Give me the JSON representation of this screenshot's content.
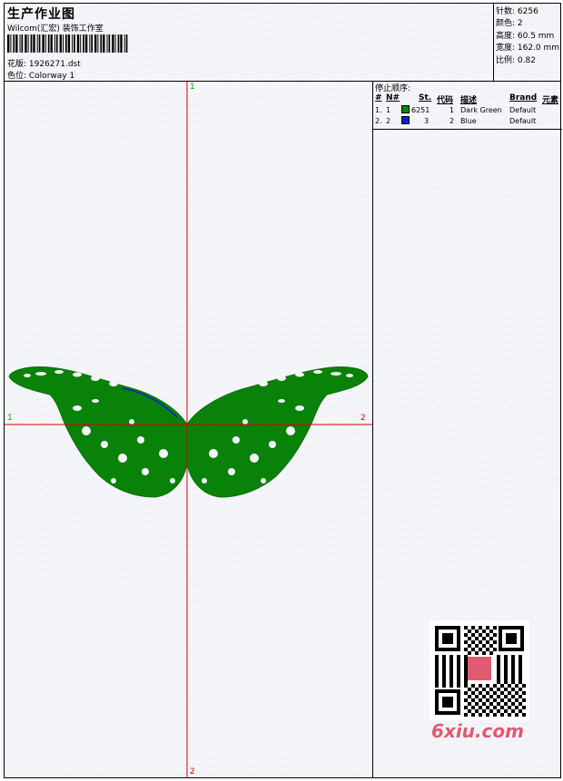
{
  "header": {
    "title": "生产作业图",
    "subtitle": "Wilcom(汇宏) 装饰工作室",
    "pattern_label": "花版: 1926271.dst",
    "colorway_label": "色位: Colorway 1"
  },
  "stats": {
    "stitches": "针数: 6256",
    "colors": "颜色: 2",
    "height": "高度: 60.5 mm",
    "width": "宽度: 162.0 mm",
    "scale": "比例: 0.82"
  },
  "stop_sequence": {
    "title": "停止顺序:",
    "columns": [
      "#",
      "N#",
      "St.",
      "代码",
      "描述",
      "Brand",
      "元素"
    ],
    "rows": [
      {
        "num": "1.",
        "n": "1",
        "stitches": "6251",
        "code": "1",
        "desc": "Dark Green",
        "brand": "Default",
        "color": "#0a8a0a"
      },
      {
        "num": "2.",
        "n": "2",
        "stitches": "3",
        "code": "2",
        "desc": "Blue",
        "brand": "Default",
        "color": "#1020d0"
      }
    ]
  },
  "axes": {
    "top": "1",
    "bottom": "2",
    "left": "1",
    "right": "2"
  },
  "watermark": {
    "brand": "6xiu.com"
  },
  "colors": {
    "stitch_green": "#0a8a0a",
    "crosshair": "#dd0000"
  }
}
